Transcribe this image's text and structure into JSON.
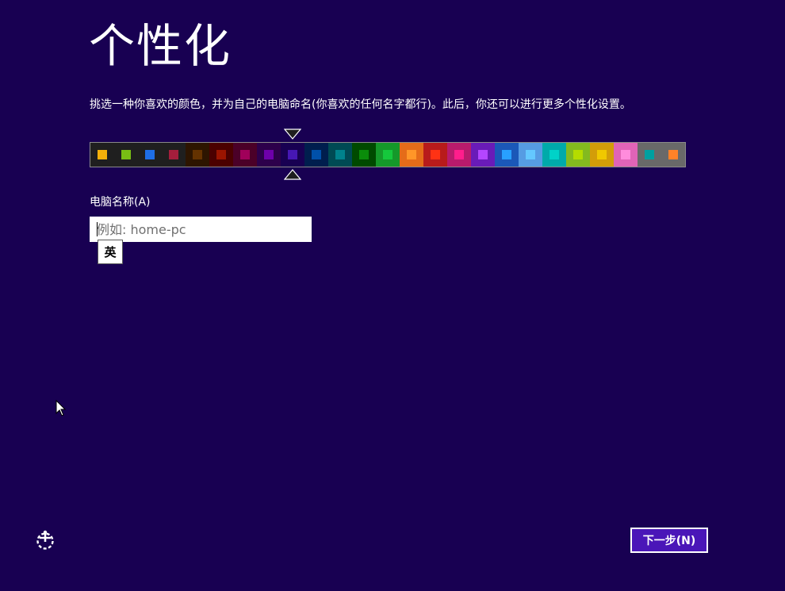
{
  "page": {
    "title": "个性化",
    "instruction": "挑选一种你喜欢的颜色，并为自己的电脑命名(你喜欢的任何名字都行)。此后，你还可以进行更多个性化设置。"
  },
  "palette": {
    "selected_index": 8,
    "swatches": [
      {
        "bg": "#1f1f1f",
        "chip": "#f4b00a"
      },
      {
        "bg": "#1f1f1f",
        "chip": "#78be14"
      },
      {
        "bg": "#1f1f1f",
        "chip": "#1e6ee6"
      },
      {
        "bg": "#1f1f1f",
        "chip": "#a51e3c"
      },
      {
        "bg": "#2d1500",
        "chip": "#643200"
      },
      {
        "bg": "#4b0000",
        "chip": "#9b1400"
      },
      {
        "bg": "#4b0028",
        "chip": "#a0005a"
      },
      {
        "bg": "#2d004b",
        "chip": "#6e00aa"
      },
      {
        "bg": "#180052",
        "chip": "#4617b4"
      },
      {
        "bg": "#001e4e",
        "chip": "#0050aa"
      },
      {
        "bg": "#004a54",
        "chip": "#00828c"
      },
      {
        "bg": "#004a00",
        "chip": "#0a8c0a"
      },
      {
        "bg": "#15992a",
        "chip": "#15c83c"
      },
      {
        "bg": "#e56c19",
        "chip": "#ff9628"
      },
      {
        "bg": "#b81b1b",
        "chip": "#ff3214"
      },
      {
        "bg": "#b81b6c",
        "chip": "#ff1e8c"
      },
      {
        "bg": "#691bb8",
        "chip": "#b446ff"
      },
      {
        "bg": "#1b58b8",
        "chip": "#28a0ff"
      },
      {
        "bg": "#569ce3",
        "chip": "#64c8ff"
      },
      {
        "bg": "#00aaaa",
        "chip": "#00d2c8"
      },
      {
        "bg": "#83ba1f",
        "chip": "#b4dc00"
      },
      {
        "bg": "#d39d09",
        "chip": "#f0c800"
      },
      {
        "bg": "#e064b7",
        "chip": "#ff8cdc"
      },
      {
        "bg": "#696969",
        "chip": "#00a0a0"
      },
      {
        "bg": "#696969",
        "chip": "#ff8228"
      }
    ]
  },
  "computer_name": {
    "label": "电脑名称(A)",
    "value": "",
    "placeholder": "例如: home-pc"
  },
  "ime": {
    "mode": "英"
  },
  "footer": {
    "next_label": "下一步(N)"
  },
  "icons": {
    "accessibility": "ease-of-access-icon",
    "cursor": "mouse-pointer-icon",
    "marker": "selection-marker-icon"
  },
  "colors": {
    "background": "#180052",
    "accent": "#4a16b8"
  }
}
